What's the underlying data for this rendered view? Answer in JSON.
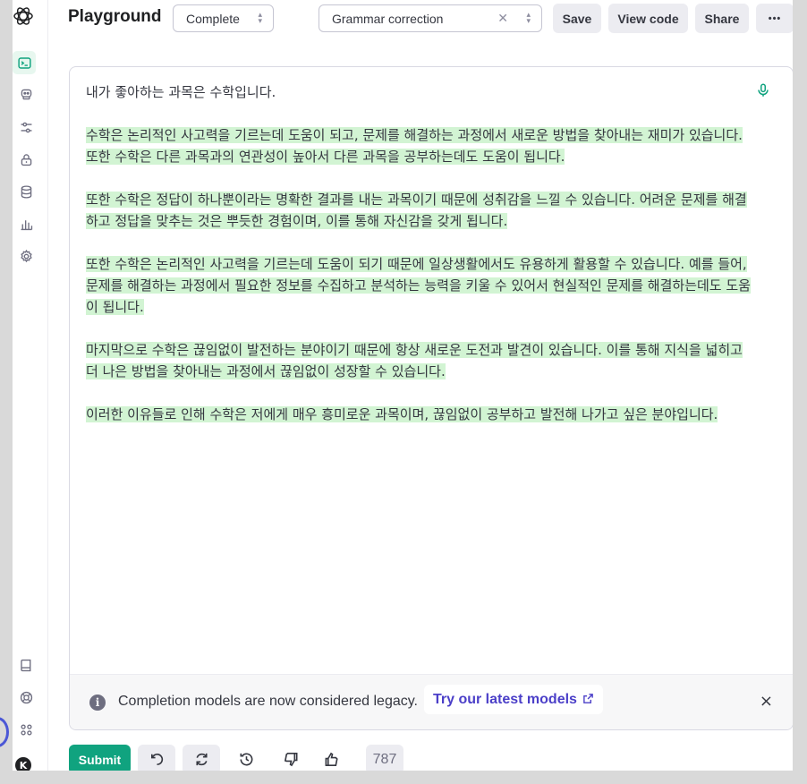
{
  "header": {
    "title": "Playground",
    "mode_select": "Complete",
    "preset_select": "Grammar correction",
    "save_label": "Save",
    "view_code_label": "View code",
    "share_label": "Share",
    "more_label": "•••"
  },
  "sidebar": {
    "logo": "openai-logo-icon",
    "items": [
      {
        "icon": "terminal-icon",
        "active": true
      },
      {
        "icon": "assistant-robot-icon"
      },
      {
        "icon": "sliders-icon"
      },
      {
        "icon": "lock-icon"
      },
      {
        "icon": "database-icon"
      },
      {
        "icon": "bar-chart-icon"
      },
      {
        "icon": "gear-icon"
      }
    ],
    "bottom": [
      {
        "icon": "book-icon"
      },
      {
        "icon": "help-lifebuoy-icon"
      },
      {
        "icon": "apps-grid-icon"
      }
    ],
    "avatar_initial": "K"
  },
  "editor": {
    "prompt": "내가 좋아하는 과목은 수학입니다.",
    "completion": [
      "수학은 논리적인 사고력을 기르는데 도움이 되고, 문제를 해결하는 과정에서 새로운 방법을 찾아내는 재미가 있습니다. 또한 수학은 다른 과목과의 연관성이 높아서 다른 과목을 공부하는데도 도움이 됩니다.",
      "또한 수학은 정답이 하나뿐이라는 명확한 결과를 내는 과목이기 때문에 성취감을 느낄 수 있습니다. 어려운 문제를 해결하고 정답을 맞추는 것은 뿌듯한 경험이며, 이를 통해 자신감을 갖게 됩니다.",
      "또한 수학은 논리적인 사고력을 기르는데 도움이 되기 때문에 일상생활에서도 유용하게 활용할 수 있습니다. 예를 들어, 문제를 해결하는 과정에서 필요한 정보를 수집하고 분석하는 능력을 키울 수 있어서 현실적인 문제를 해결하는데도 도움이 됩니다.",
      "마지막으로 수학은 끊임없이 발전하는 분야이기 때문에 항상 새로운 도전과 발견이 있습니다. 이를 통해 지식을 넓히고 더 나은 방법을 찾아내는 과정에서 끊임없이 성장할 수 있습니다.",
      "이러한 이유들로 인해 수학은 저에게 매우 흥미로운 과목이며, 끊임없이 공부하고 발전해 나가고 싶은 분야입니다."
    ],
    "highlight_color": "#d2f4d3"
  },
  "notice": {
    "text": "Completion models are now considered legacy.",
    "link": "Try our latest models",
    "close": "×"
  },
  "footer": {
    "submit_label": "Submit",
    "token_count": "787"
  },
  "colors": {
    "accent": "#10a37f",
    "link": "#4b3fc8"
  }
}
